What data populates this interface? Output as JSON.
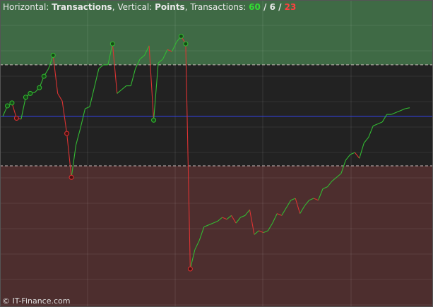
{
  "header": {
    "horizontal_label": "Horizontal: ",
    "horizontal_value": "Transactions",
    "sep1": ", ",
    "vertical_label": "Vertical: ",
    "vertical_value": "Points",
    "sep2": ", ",
    "transactions_label": "Transactions: ",
    "count_won": "60",
    "slash1": " / ",
    "count_neutral": "6",
    "slash2": " / ",
    "count_lost": "23"
  },
  "footer": {
    "credit": "© IT-Finance.com"
  },
  "colors": {
    "upper_zone": "#3f6a45",
    "middle_zone": "#222222",
    "lower_zone": "#4d2e2e",
    "up_line": "#33bb33",
    "down_line": "#dd3333",
    "baseline": "#3344ee",
    "threshold": "#c8b8b8"
  },
  "chart_data": {
    "type": "line",
    "x_label": "Transactions",
    "y_label": "Points",
    "x_range": [
      0,
      89
    ],
    "y_range": [
      -1.0,
      0.61
    ],
    "upper_threshold": 0.27,
    "baseline": 0,
    "lower_threshold": -0.26,
    "grid": true,
    "counts": {
      "won": 60,
      "neutral": 6,
      "lost": 23
    },
    "values": [
      0.0,
      0.055,
      0.07,
      -0.01,
      -0.015,
      0.1,
      0.12,
      0.125,
      0.15,
      0.21,
      0.25,
      0.32,
      0.12,
      0.08,
      -0.09,
      -0.32,
      -0.15,
      -0.06,
      0.04,
      0.05,
      0.15,
      0.25,
      0.27,
      0.27,
      0.38,
      0.12,
      0.14,
      0.16,
      0.16,
      0.25,
      0.3,
      0.32,
      0.37,
      -0.02,
      0.28,
      0.3,
      0.35,
      0.34,
      0.39,
      0.42,
      0.38,
      -0.8,
      -0.7,
      -0.65,
      -0.58,
      -0.57,
      -0.56,
      -0.55,
      -0.53,
      -0.54,
      -0.52,
      -0.56,
      -0.53,
      -0.52,
      -0.49,
      -0.62,
      -0.6,
      -0.61,
      -0.6,
      -0.56,
      -0.51,
      -0.52,
      -0.48,
      -0.44,
      -0.43,
      -0.51,
      -0.47,
      -0.44,
      -0.43,
      -0.44,
      -0.38,
      -0.37,
      -0.34,
      -0.32,
      -0.3,
      -0.23,
      -0.2,
      -0.19,
      -0.22,
      -0.14,
      -0.11,
      -0.05,
      -0.04,
      -0.03,
      0.01,
      0.01,
      0.02,
      0.03,
      0.04,
      0.045
    ],
    "marked_points": [
      {
        "x": 1,
        "type": "peak"
      },
      {
        "x": 2,
        "type": "peak"
      },
      {
        "x": 3,
        "type": "trough"
      },
      {
        "x": 5,
        "type": "peak"
      },
      {
        "x": 6,
        "type": "peak"
      },
      {
        "x": 8,
        "type": "peak"
      },
      {
        "x": 9,
        "type": "peak"
      },
      {
        "x": 11,
        "type": "peak"
      },
      {
        "x": 14,
        "type": "trough"
      },
      {
        "x": 15,
        "type": "trough"
      },
      {
        "x": 24,
        "type": "peak"
      },
      {
        "x": 33,
        "type": "peak"
      },
      {
        "x": 39,
        "type": "peak"
      },
      {
        "x": 40,
        "type": "peak"
      },
      {
        "x": 41,
        "type": "trough"
      }
    ]
  }
}
